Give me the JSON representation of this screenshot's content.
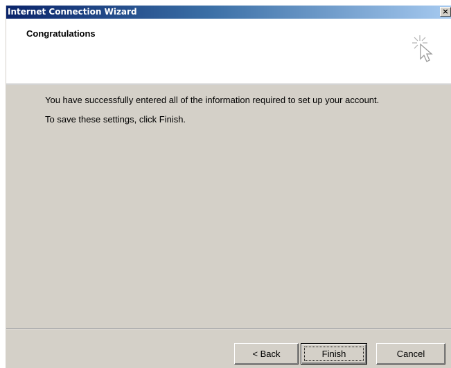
{
  "window": {
    "title": "Internet Connection Wizard",
    "close_label": "×"
  },
  "header": {
    "title": "Congratulations",
    "icon": "wizard-cursor-sparkle-icon"
  },
  "body": {
    "line1": "You have successfully entered all of the information required to set up your account.",
    "line2": "To save these settings, click Finish."
  },
  "buttons": {
    "back": "< Back",
    "finish": "Finish",
    "cancel": "Cancel"
  },
  "colors": {
    "titlebar_start": "#0a246a",
    "titlebar_end": "#a6caf0",
    "dialog_face": "#d4d0c8",
    "header_bg": "#ffffff"
  }
}
